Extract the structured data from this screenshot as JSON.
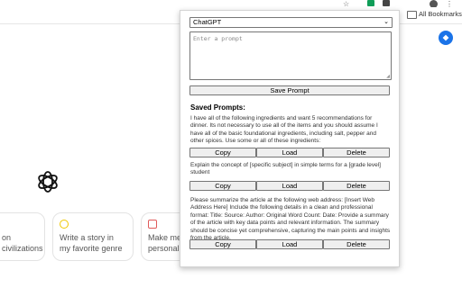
{
  "bookmarks": {
    "all_bookmarks": "All Bookmarks"
  },
  "chat": {
    "cards": [
      {
        "line1": "on",
        "line2": "civilizations",
        "icon_color": "#f0b429"
      },
      {
        "line1": "Write a story in",
        "line2": "my favorite genre",
        "icon_color": "#f0c800"
      },
      {
        "line1": "Make me",
        "line2": "personal w",
        "icon_color": "#e05a5a"
      }
    ]
  },
  "popup": {
    "model": "ChatGPT",
    "prompt_placeholder": "Enter a prompt",
    "save_label": "Save Prompt",
    "saved_heading": "Saved Prompts:",
    "prompts": [
      {
        "text": "I have all of the following ingredients and want 5 recommendations for dinner. Its not necessary to use all of the items and you should assume I have all of the basic foundational ingredients, including salt, pepper and other spices. Use some or all of these ingredients:",
        "copy": "Copy",
        "load": "Load",
        "delete": "Delete"
      },
      {
        "text": "Explain the concept of [specific subject] in simple terms for a [grade level] student",
        "copy": "Copy",
        "load": "Load",
        "delete": "Delete"
      },
      {
        "text": "Please summarize the article at the following web address: [Insert Web Address Here] Include the following details in a clean and professional format: Title: Source: Author: Original Word Count: Date: Provide a summary of the article with key data points and relevant information. The summary should be concise yet comprehensive, capturing the main points and insights from the article.",
        "copy": "Copy",
        "load": "Load",
        "delete": "Delete"
      }
    ]
  }
}
